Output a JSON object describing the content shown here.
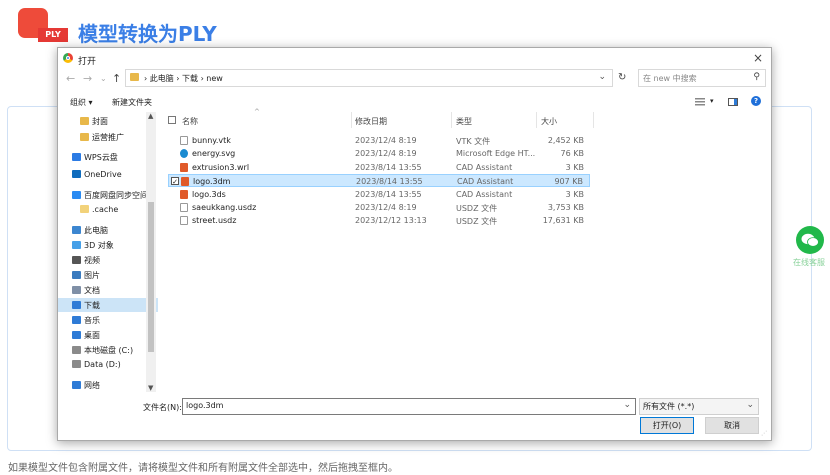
{
  "page": {
    "logo_tag": "PLY",
    "title": "模型转换为PLY",
    "hint": "如果模型文件包含附属文件，请将模型文件和所有附属文件全部选中，然后拖拽至框内。",
    "wechat_label": "在线客服"
  },
  "dialog": {
    "title": "打开",
    "close": "×",
    "nav": {
      "back": "←",
      "forward": "→",
      "dropdown": "⌄",
      "up": "↑"
    },
    "address_path": "›  此电脑  ›  下载  ›  new",
    "address_caret": "⌄",
    "refresh": "↻",
    "search_placeholder": "在 new 中搜索",
    "search_icon": "⚲",
    "toolbar": {
      "organize": "组织 ▾",
      "new_folder": "新建文件夹",
      "help": "?"
    },
    "nav_items": [
      {
        "label": "封面",
        "icon": "folder-icon",
        "color": "#e8b84a"
      },
      {
        "label": "运营推广",
        "icon": "folder-icon",
        "color": "#e8b84a"
      },
      {
        "label": "WPS云盘",
        "icon": "cloud-icon",
        "color": "#2b7be4"
      },
      {
        "label": "OneDrive",
        "icon": "cloud-icon",
        "color": "#0f6cbd"
      },
      {
        "label": "百度网盘同步空间",
        "icon": "baidu-icon",
        "color": "#2a8bf2"
      },
      {
        "label": ".cache",
        "icon": "folder-icon",
        "color": "#f2d27a"
      },
      {
        "label": "此电脑",
        "icon": "pc-icon",
        "color": "#3c86d0"
      },
      {
        "label": "3D 对象",
        "icon": "3d-icon",
        "color": "#46a0e8"
      },
      {
        "label": "视频",
        "icon": "video-icon",
        "color": "#555555"
      },
      {
        "label": "图片",
        "icon": "picture-icon",
        "color": "#3a7bbf"
      },
      {
        "label": "文档",
        "icon": "document-icon",
        "color": "#7f8fa6"
      },
      {
        "label": "下载",
        "icon": "download-icon",
        "color": "#2e7bd6"
      },
      {
        "label": "音乐",
        "icon": "music-icon",
        "color": "#2e7bd6"
      },
      {
        "label": "桌面",
        "icon": "desktop-icon",
        "color": "#2e7bd6"
      },
      {
        "label": "本地磁盘 (C:)",
        "icon": "drive-icon",
        "color": "#8a8a8a"
      },
      {
        "label": "Data (D:)",
        "icon": "drive-icon",
        "color": "#8a8a8a"
      },
      {
        "label": "网络",
        "icon": "network-icon",
        "color": "#2e7bd6"
      }
    ],
    "selected_nav": "下载",
    "columns": {
      "name": "名称",
      "date": "修改日期",
      "type": "类型",
      "size": "大小"
    },
    "files": [
      {
        "name": "bunny.vtk",
        "date": "2023/12/4 8:19",
        "type": "VTK 文件",
        "size": "2,452 KB",
        "icon": "file-icon",
        "color": "#ffffff",
        "selected": false
      },
      {
        "name": "energy.svg",
        "date": "2023/12/4 8:19",
        "type": "Microsoft Edge HT...",
        "size": "76 KB",
        "icon": "edge-icon",
        "color": "#1b8bd1",
        "selected": false
      },
      {
        "name": "extrusion3.wrl",
        "date": "2023/8/14 13:55",
        "type": "CAD Assistant",
        "size": "3 KB",
        "icon": "cad-icon",
        "color": "#e05a2a",
        "selected": false
      },
      {
        "name": "logo.3dm",
        "date": "2023/8/14 13:55",
        "type": "CAD Assistant",
        "size": "907 KB",
        "icon": "cad-icon",
        "color": "#e05a2a",
        "selected": true
      },
      {
        "name": "logo.3ds",
        "date": "2023/8/14 13:55",
        "type": "CAD Assistant",
        "size": "3 KB",
        "icon": "cad-icon",
        "color": "#e05a2a",
        "selected": false
      },
      {
        "name": "saeukkang.usdz",
        "date": "2023/12/4 8:19",
        "type": "USDZ 文件",
        "size": "3,753 KB",
        "icon": "file-icon",
        "color": "#ffffff",
        "selected": false
      },
      {
        "name": "street.usdz",
        "date": "2023/12/12 13:13",
        "type": "USDZ 文件",
        "size": "17,631 KB",
        "icon": "file-icon",
        "color": "#ffffff",
        "selected": false
      }
    ],
    "filename_label": "文件名(N):",
    "filename_value": "logo.3dm",
    "filter_value": "所有文件 (*.*)",
    "open_button": "打开(O)",
    "cancel_button": "取消"
  }
}
